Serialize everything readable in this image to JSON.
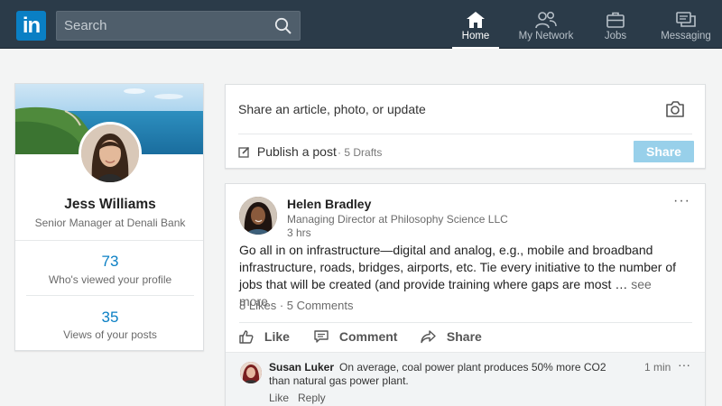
{
  "nav": {
    "logo": "in",
    "search_placeholder": "Search",
    "items": [
      {
        "label": "Home",
        "icon": "home-icon",
        "active": true
      },
      {
        "label": "My Network",
        "icon": "network-icon"
      },
      {
        "label": "Jobs",
        "icon": "briefcase-icon"
      },
      {
        "label": "Messaging",
        "icon": "messaging-icon"
      }
    ]
  },
  "profile": {
    "name": "Jess Williams",
    "title": "Senior Manager at Denali Bank",
    "stats": [
      {
        "value": "73",
        "label": "Who's viewed your profile"
      },
      {
        "value": "35",
        "label": "Views of your posts"
      }
    ]
  },
  "share_box": {
    "prompt": "Share an article, photo, or update",
    "publish_label": "Publish a post",
    "drafts": "5 Drafts",
    "share_label": "Share"
  },
  "post": {
    "author": "Helen Bradley",
    "author_title": "Managing Director at Philosophy Science LLC",
    "time": "3 hrs",
    "body": "Go all in on infrastructure—digital and analog, e.g., mobile and broadband infrastructure, roads, bridges, airports, etc. Tie every initiative to the number of jobs that will be created (and provide training where gaps are most …",
    "see_more": "see more",
    "likes": "8 Likes",
    "comments": "5 Comments",
    "actions": {
      "like": "Like",
      "comment": "Comment",
      "share": "Share"
    }
  },
  "comment": {
    "author": "Susan Luker",
    "text": "On average, coal power plant produces 50% more CO2 than natural gas power plant.",
    "time": "1 min",
    "like": "Like",
    "reply": "Reply"
  },
  "colors": {
    "nav_bg": "#2b3b49",
    "brand_blue": "#0a7fc4",
    "share_button": "#98d0ea",
    "page_bg": "#f3f4f4"
  }
}
